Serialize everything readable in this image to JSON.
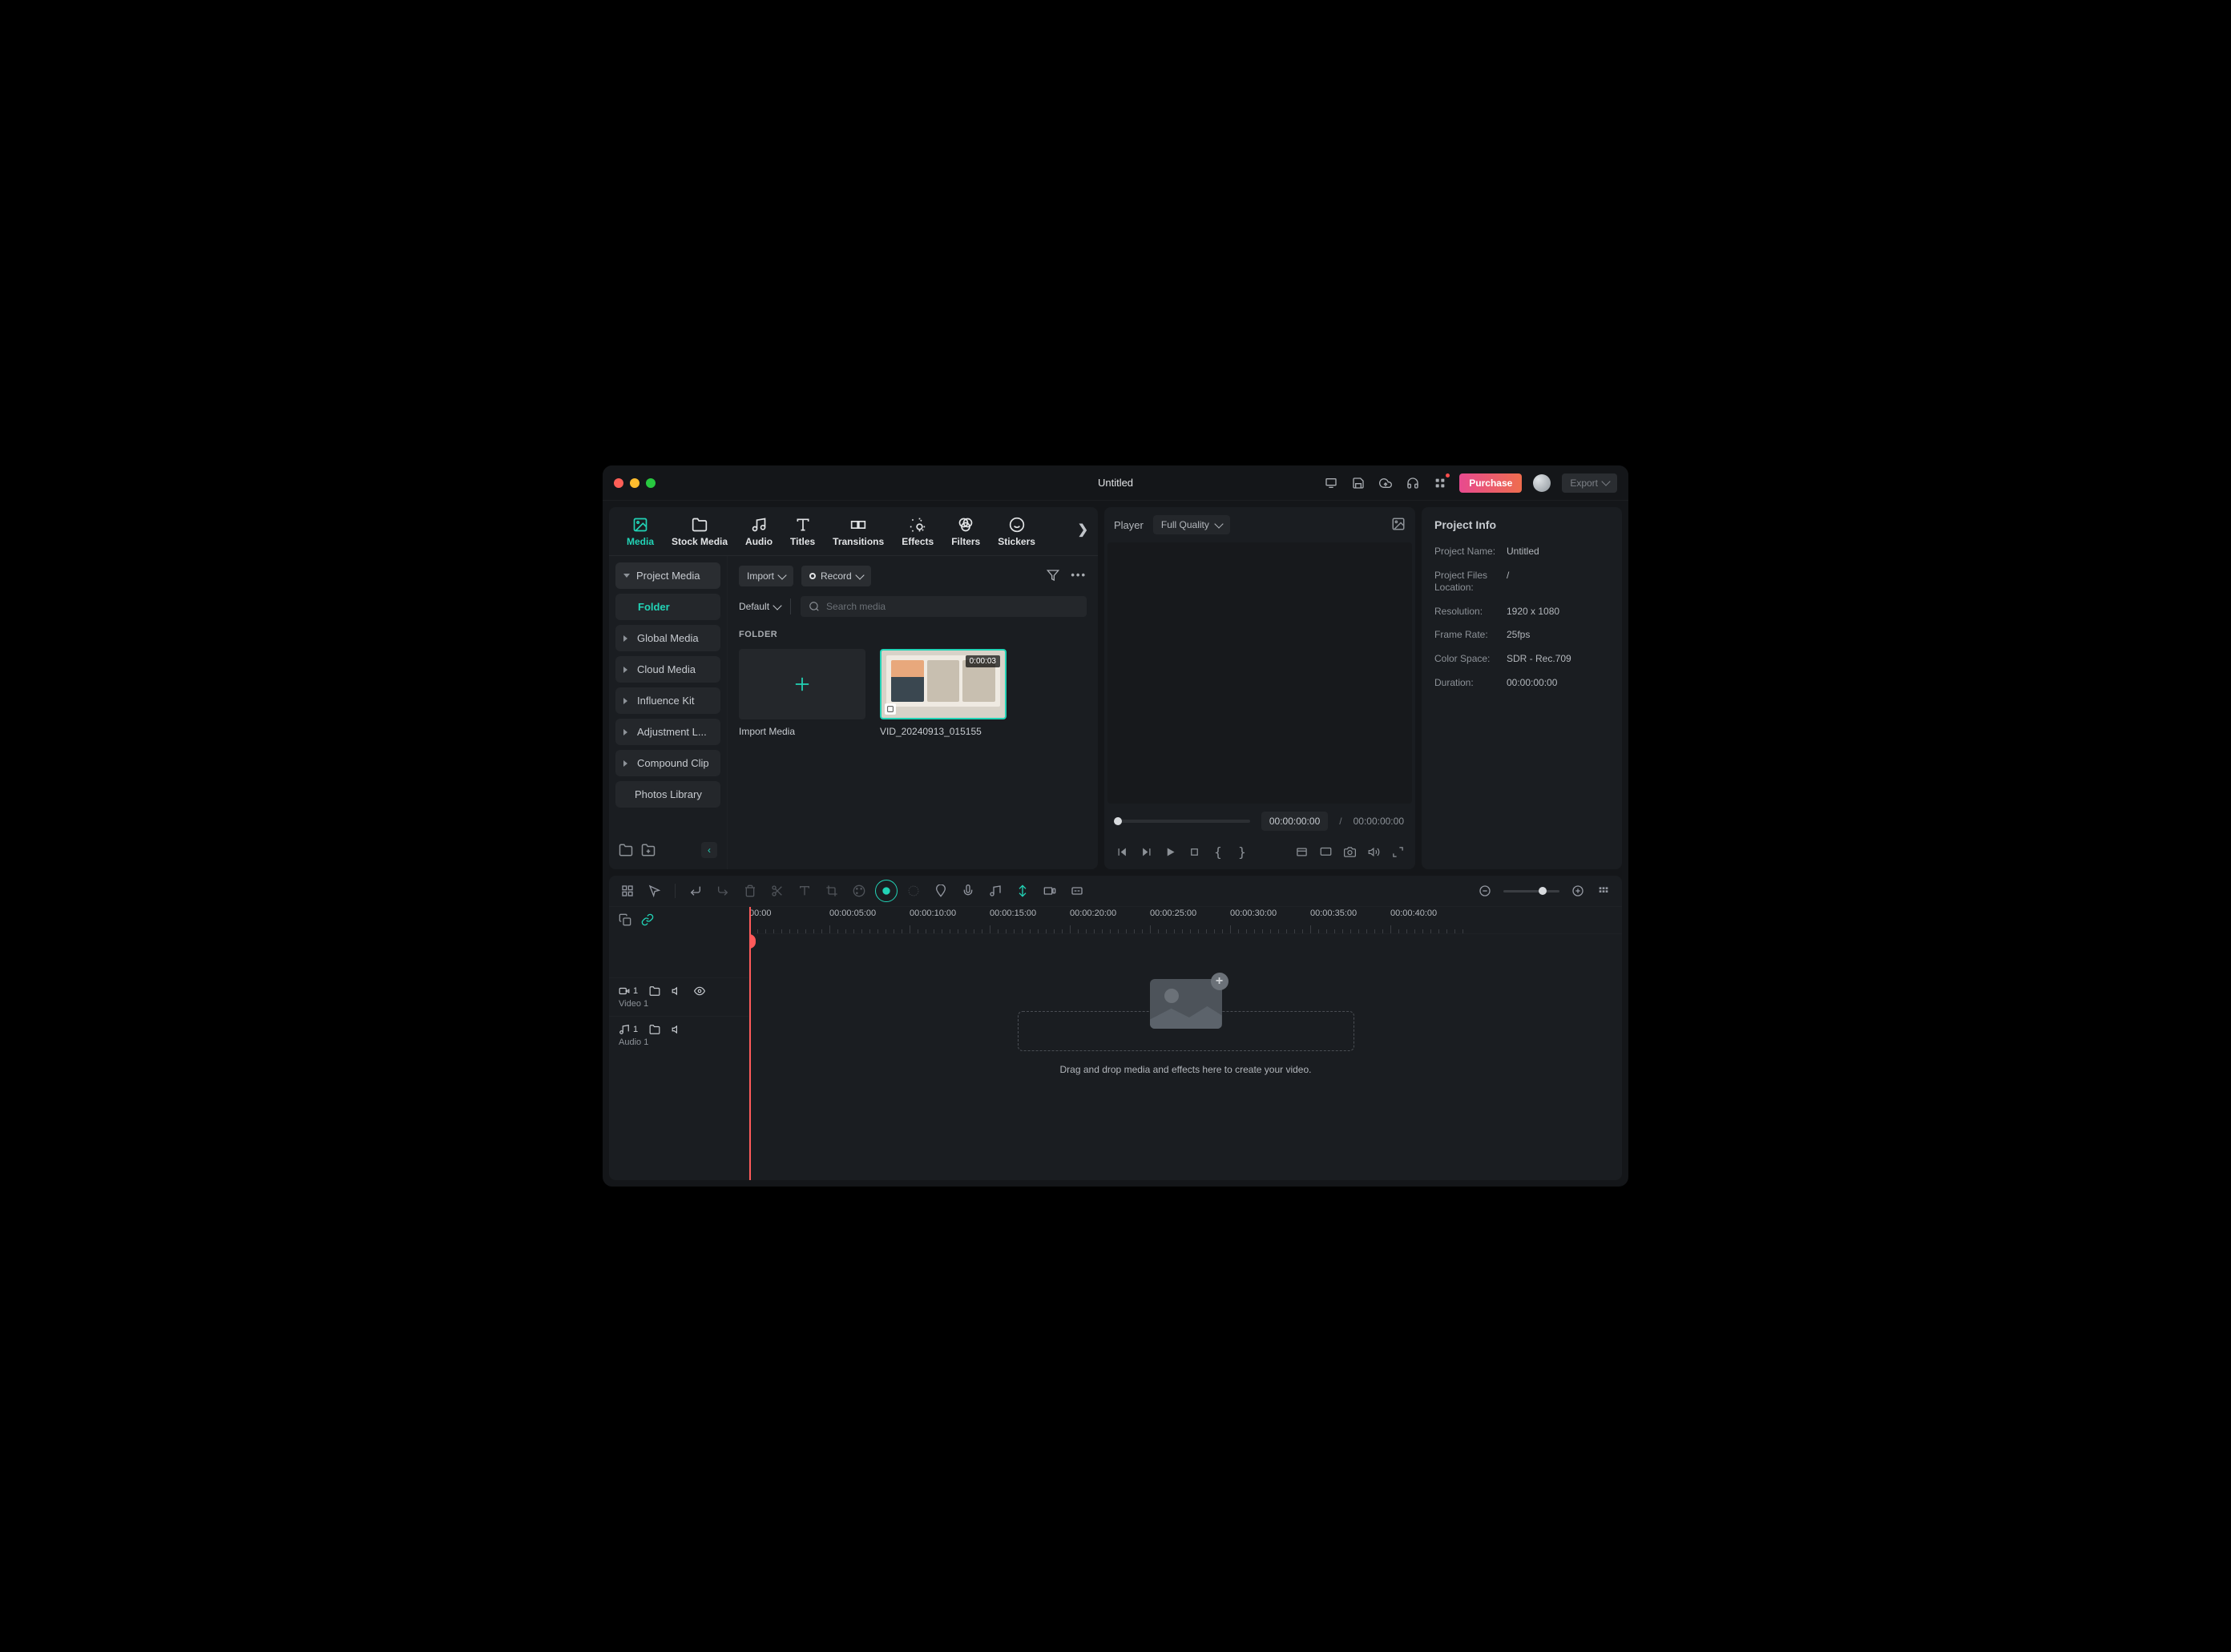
{
  "title": "Untitled",
  "toolbar": {
    "purchase": "Purchase",
    "export": "Export"
  },
  "mediaTabs": [
    {
      "id": "media",
      "label": "Media",
      "active": true
    },
    {
      "id": "stock",
      "label": "Stock Media"
    },
    {
      "id": "audio",
      "label": "Audio"
    },
    {
      "id": "titles",
      "label": "Titles"
    },
    {
      "id": "transitions",
      "label": "Transitions"
    },
    {
      "id": "effects",
      "label": "Effects"
    },
    {
      "id": "filters",
      "label": "Filters"
    },
    {
      "id": "stickers",
      "label": "Stickers"
    }
  ],
  "mediaSidebar": {
    "projectMedia": "Project Media",
    "folder": "Folder",
    "globalMedia": "Global Media",
    "cloudMedia": "Cloud Media",
    "influenceKit": "Influence Kit",
    "adjustment": "Adjustment L...",
    "compound": "Compound Clip",
    "photos": "Photos Library"
  },
  "mediaBar": {
    "import": "Import",
    "record": "Record",
    "sort": "Default",
    "searchPlaceholder": "Search media",
    "folderLabel": "FOLDER"
  },
  "mediaItems": {
    "importCard": "Import Media",
    "clip": {
      "name": "VID_20240913_015155",
      "duration": "0:00:03"
    }
  },
  "player": {
    "label": "Player",
    "quality": "Full Quality",
    "current": "00:00:00:00",
    "sep": "/",
    "total": "00:00:00:00"
  },
  "projectInfo": {
    "title": "Project Info",
    "rows": [
      {
        "k": "Project Name:",
        "v": "Untitled"
      },
      {
        "k": "Project Files Location:",
        "v": "/"
      },
      {
        "k": "Resolution:",
        "v": "1920 x 1080"
      },
      {
        "k": "Frame Rate:",
        "v": "25fps"
      },
      {
        "k": "Color Space:",
        "v": "SDR - Rec.709"
      },
      {
        "k": "Duration:",
        "v": "00:00:00:00"
      }
    ]
  },
  "timeline": {
    "ruler": [
      "00:00",
      "00:00:05:00",
      "00:00:10:00",
      "00:00:15:00",
      "00:00:20:00",
      "00:00:25:00",
      "00:00:30:00",
      "00:00:35:00",
      "00:00:40:00"
    ],
    "tracks": {
      "video": {
        "num": "1",
        "label": "Video 1"
      },
      "audio": {
        "num": "1",
        "label": "Audio 1"
      }
    },
    "dropText": "Drag and drop media and effects here to create your video."
  }
}
